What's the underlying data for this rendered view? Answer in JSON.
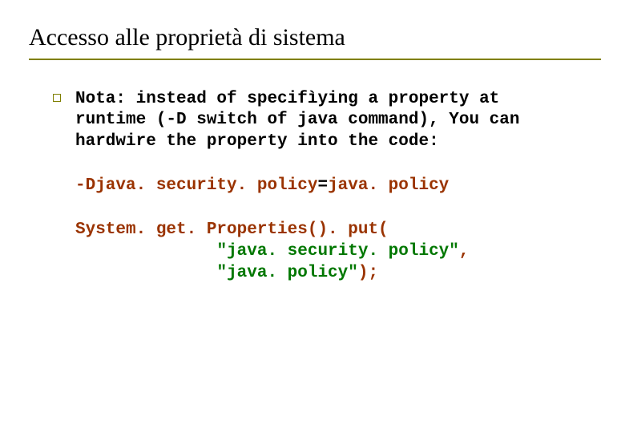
{
  "title": "Accesso alle proprietà di sistema",
  "body": {
    "note": "Nota: instead of specifìying a property at\nruntime (-D switch of java command), You can\nhardwire the property into the code:",
    "cmd_prefix": "-Djava. security. policy",
    "cmd_eq": "=",
    "cmd_value": "java. policy",
    "code_l1": "System. get. Properties(). put(",
    "code_l2_indent": "              ",
    "code_l2_str": "\"java. security. policy\"",
    "code_l2_tail": ",",
    "code_l3_indent": "              ",
    "code_l3_str": "\"java. policy\"",
    "code_l3_tail": ");"
  }
}
